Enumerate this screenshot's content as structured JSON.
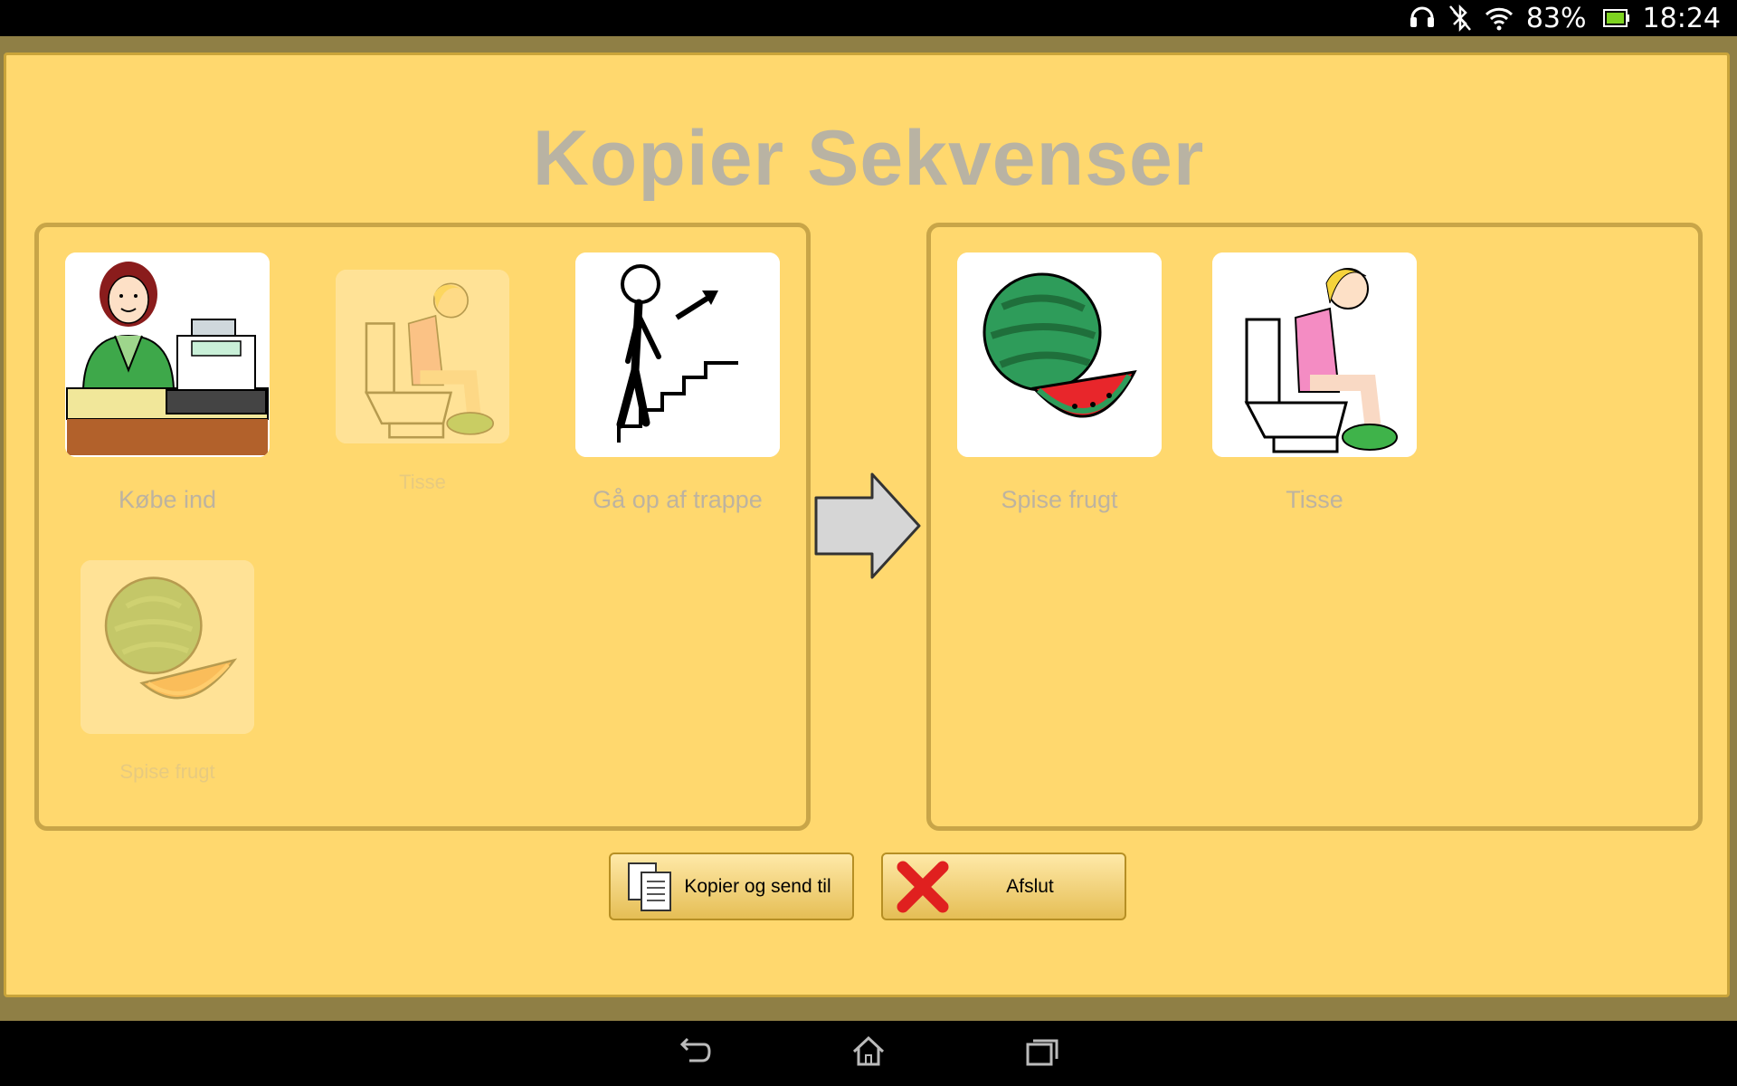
{
  "status": {
    "battery_percent": "83%",
    "time": "18:24",
    "icons": [
      "headset-icon",
      "bluetooth-off-icon",
      "wifi-icon",
      "battery-icon"
    ]
  },
  "page": {
    "title": "Kopier Sekvenser"
  },
  "source_sequences": [
    {
      "label": "Købe ind",
      "icon": "cashier-icon",
      "faded": false
    },
    {
      "label": "Tisse",
      "icon": "toilet-icon",
      "faded": true
    },
    {
      "label": "Gå op af trappe",
      "icon": "stairs-up-icon",
      "faded": false
    },
    {
      "label": "Spise frugt",
      "icon": "melon-icon",
      "faded": true
    }
  ],
  "selected_sequences": [
    {
      "label": "Spise frugt",
      "icon": "watermelon-icon"
    },
    {
      "label": "Tisse",
      "icon": "toilet-icon"
    }
  ],
  "buttons": {
    "copy_send": "Kopier og send til",
    "exit": "Afslut"
  },
  "colors": {
    "background": "#ffd86e",
    "frame": "#c8a548",
    "title": "#b9b3a3"
  }
}
